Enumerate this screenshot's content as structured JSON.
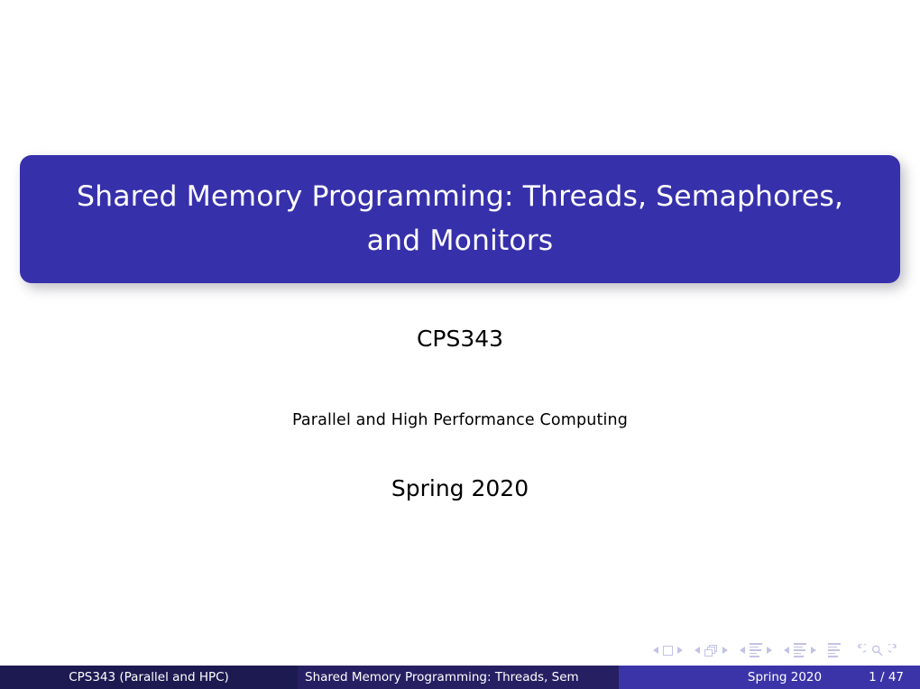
{
  "slide": {
    "title": "Shared Memory Programming: Threads, Semaphores, and Monitors",
    "course_code": "CPS343",
    "subject": "Parallel and High Performance Computing",
    "term": "Spring 2020"
  },
  "footer": {
    "author": "CPS343  (Parallel and HPC)",
    "short_title": "Shared Memory Programming: Threads, Sem",
    "date": "Spring 2020",
    "page": "1 / 47"
  },
  "navigation": {
    "slide_prev": "slide-previous",
    "slide_marker": "slide-current",
    "slide_next": "slide-next",
    "frame_prev": "frame-previous",
    "frame_marker": "frames-stack",
    "frame_next": "frame-next",
    "subsection_prev": "subsection-previous",
    "subsection_marker": "subsection-current",
    "subsection_next": "subsection-next",
    "section_prev": "section-previous",
    "section_marker": "section-current",
    "section_next": "section-next",
    "doc_marker": "document",
    "back": "go-back",
    "find": "find",
    "forward": "go-forward"
  },
  "colors": {
    "title_box": "#3730ab",
    "title_text": "#ffffff",
    "footer_author_bg": "#1d1a51",
    "footer_title_bg": "#262063",
    "footer_date_bg": "#3b34a8",
    "nav_symbol": "#c2c2e6",
    "page_bg": "#ffffff",
    "body_text": "#000000"
  }
}
